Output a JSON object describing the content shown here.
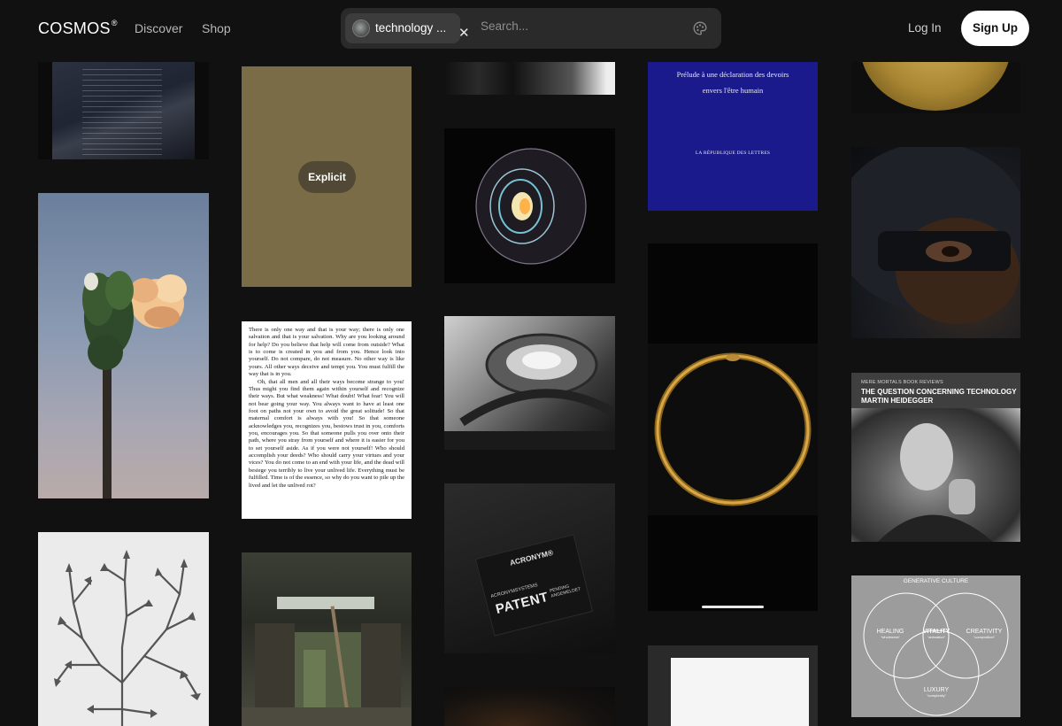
{
  "header": {
    "logo": "COSMOS",
    "logo_mark": "®",
    "nav": {
      "discover": "Discover",
      "shop": "Shop"
    },
    "search": {
      "chip_label": "technology ...",
      "chip_close": "✕",
      "placeholder": "Search..."
    },
    "login": "Log In",
    "signup": "Sign Up"
  },
  "tiles": {
    "explicit_label": "Explicit",
    "blue_book": {
      "line1": "Prélude à une déclaration des devoirs",
      "line2": "envers l'être humain",
      "line3": "LA RÉPUBLIQUE DES LETTRES"
    },
    "text_page": {
      "para1": "There is only one way and that is your way; there is only one salvation and that is your salvation. Why are you looking around for help? Do you believe that help will come from outside? What is to come is created in you and from you. Hence look into yourself. Do not compare, do not measure. No other way is like yours. All other ways deceive and tempt you. You must fulfill the way that is in you.",
      "para2": "Oh, that all men and all their ways become strange to you! Thus might you find them again within yourself and recognize their ways. But what weakness! What doubt! What fear! You will not bear going your way. You always want to have at least one foot on paths not your own to avoid the great solitude! So that maternal comfort is always with you! So that someone acknowledges you, recognizes you, bestows trust in you, comforts you, encourages you. So that someone pulls you over onto their path, where you stray from yourself and where it is easier for you to set yourself aside. As if you were not yourself! Who should accomplish your deeds? Who should carry your virtues and your vices? You do not come to an end with your life, and the dead will besiege you terribly to live your unlived life. Everything must be fulfilled. Time is of the essence, so why do you want to pile up the lived and let the unlived rot?"
    },
    "heidegger": {
      "small": "MERE MORTALS BOOK REVIEWS",
      "title_line1": "THE QUESTION CONCERNING TECHNOLOGY",
      "title_line2": "MARTIN HEIDEGGER"
    },
    "patent": {
      "brand": "ACRONYM®",
      "systems": "ACRONYMSYSTEMS",
      "patent": "PATENT",
      "pending": "PENDING ANGEMELDET"
    },
    "venn": {
      "title": "GENERATIVE CULTURE",
      "c1": "HEALING",
      "c1_sub": "\"wholeness\"",
      "c2": "VITALITY",
      "c2_sub": "\"animation\"",
      "c3": "CREATIVITY",
      "c3_sub": "\"composition\"",
      "c4": "LUXURY",
      "c4_sub": "\"complexity\""
    }
  },
  "colors": {
    "background": "#111111",
    "signup_bg": "#ffffff",
    "search_bg": "#2a2a2a"
  }
}
